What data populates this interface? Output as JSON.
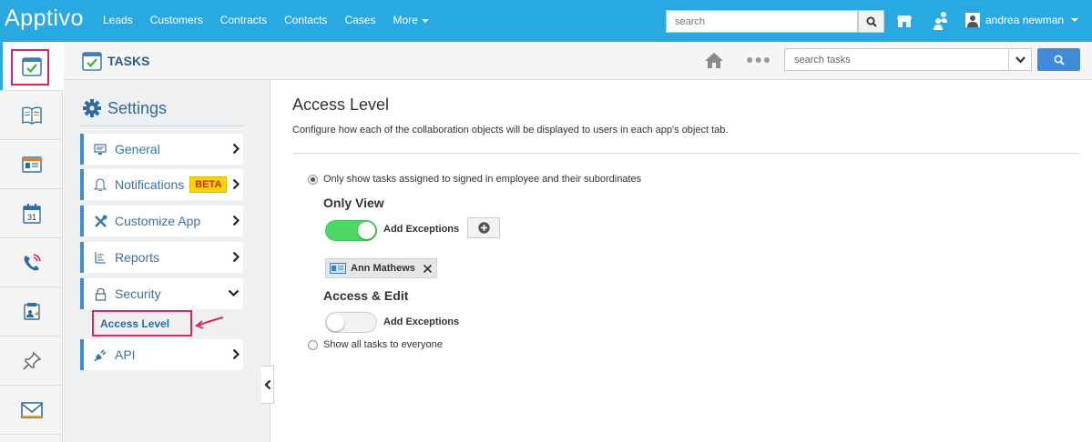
{
  "topnav": {
    "logo": "Apptivo",
    "links": [
      "Leads",
      "Customers",
      "Contracts",
      "Contacts",
      "Cases"
    ],
    "more": "More",
    "search_placeholder": "search",
    "user_name": "andrea newman"
  },
  "rail": {
    "items": [
      "tasks-icon",
      "book-icon",
      "contact-card-icon",
      "calendar-icon",
      "phone-icon",
      "id-card-icon",
      "pin-icon",
      "mail-icon"
    ],
    "calendar_day": "31"
  },
  "header": {
    "app_title": "TASKS",
    "search_placeholder": "search tasks"
  },
  "settings": {
    "title": "Settings",
    "items": [
      {
        "label": "General",
        "icon": "monitor-icon"
      },
      {
        "label": "Notifications",
        "icon": "bell-icon",
        "badge": "BETA"
      },
      {
        "label": "Customize App",
        "icon": "tools-icon"
      },
      {
        "label": "Reports",
        "icon": "report-icon"
      },
      {
        "label": "Security",
        "icon": "lock-icon"
      },
      {
        "label": "API",
        "icon": "plug-icon"
      }
    ],
    "sub_item": "Access Level"
  },
  "content": {
    "title": "Access Level",
    "description": "Configure how each of the collaboration objects will be displayed to users in each app's object tab.",
    "option1": "Only show tasks assigned to signed in employee and their subordinates",
    "only_view_title": "Only View",
    "add_exceptions_1": "Add Exceptions",
    "chip_name": "Ann Mathews",
    "access_edit_title": "Access & Edit",
    "add_exceptions_2": "Add Exceptions",
    "option2": "Show all tasks to everyone"
  },
  "colors": {
    "brand": "#29a9e1",
    "accent": "#3d8bd9",
    "toggle_on": "#4cd964",
    "highlight": "#e0245e",
    "beta_bg": "#ffd200"
  }
}
